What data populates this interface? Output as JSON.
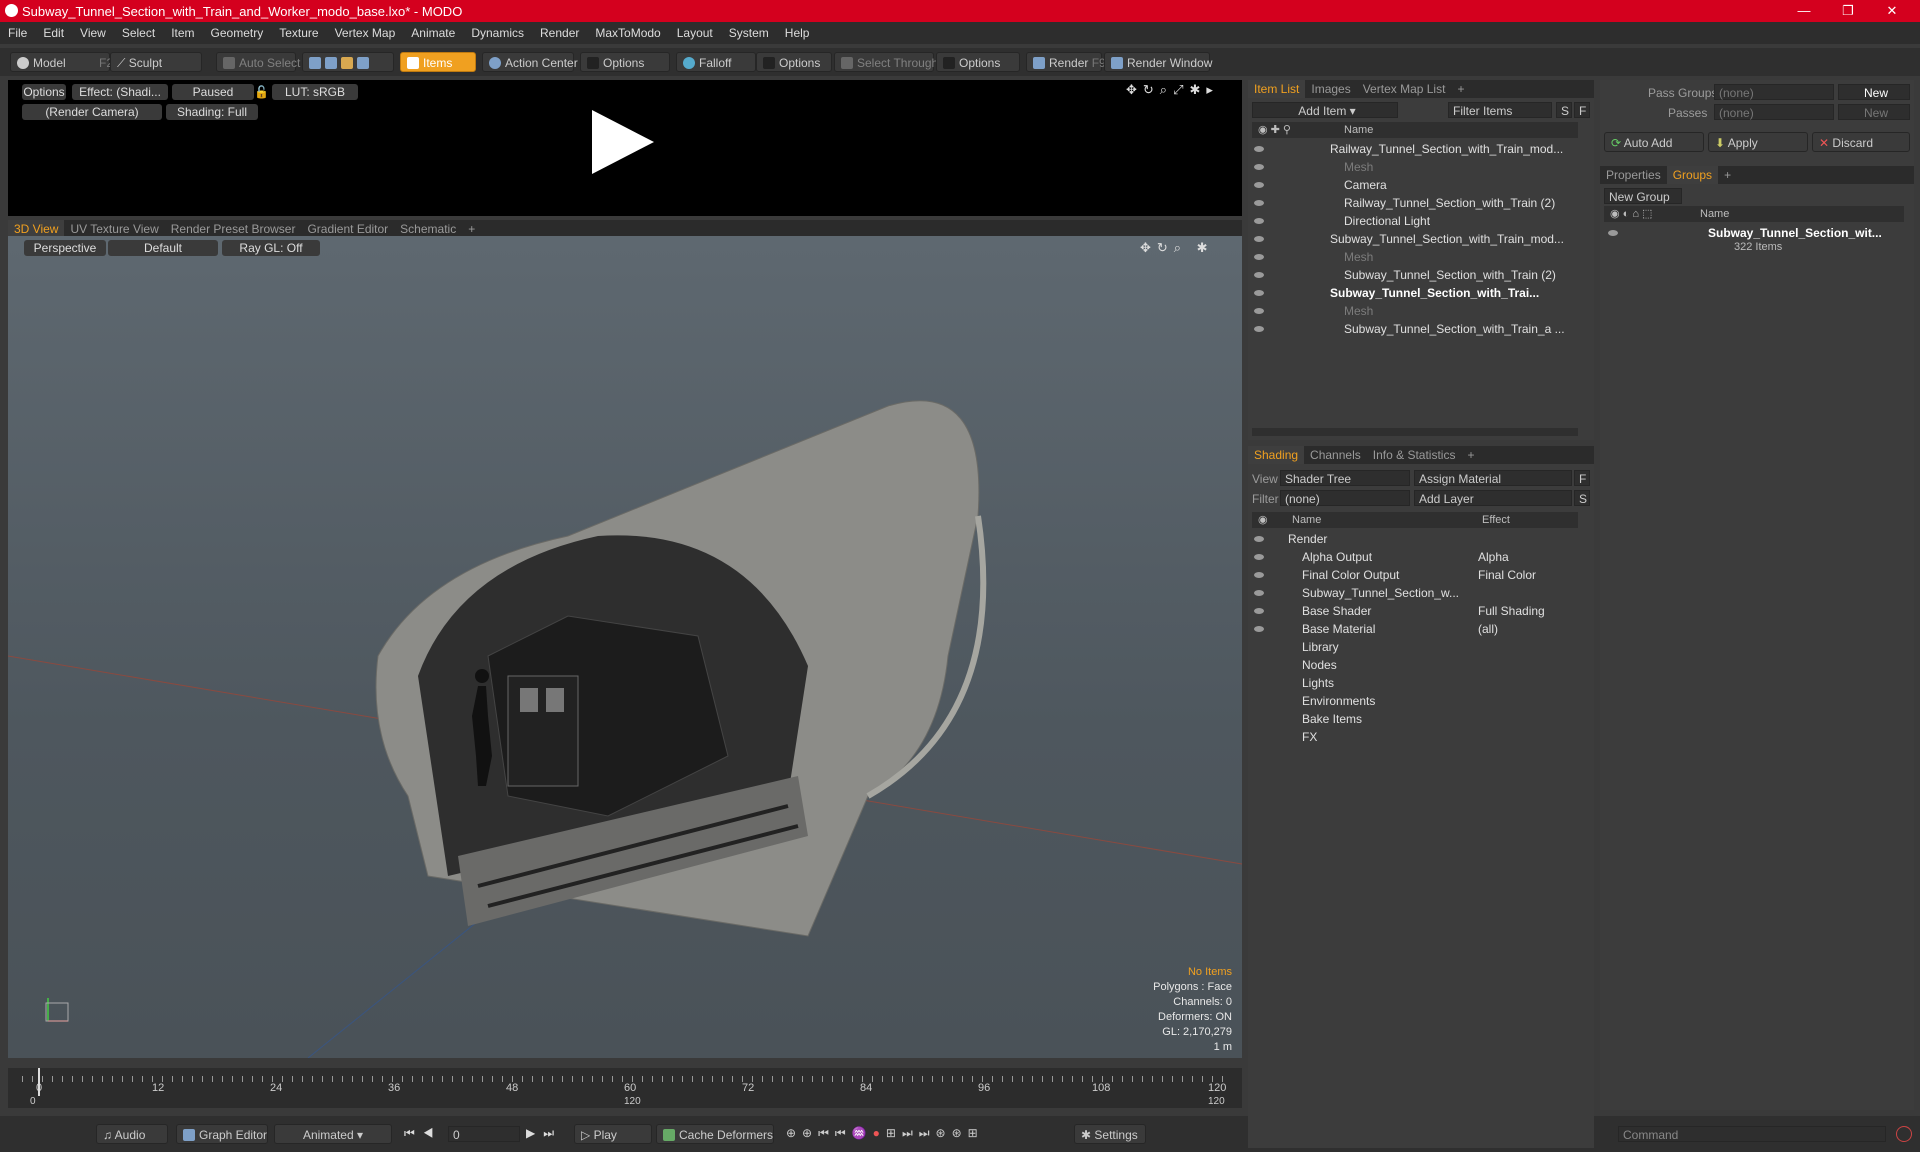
{
  "window": {
    "title": "Subway_Tunnel_Section_with_Train_and_Worker_modo_base.lxo* - MODO"
  },
  "menu": [
    "File",
    "Edit",
    "View",
    "Select",
    "Item",
    "Geometry",
    "Texture",
    "Vertex Map",
    "Animate",
    "Dynamics",
    "Render",
    "MaxToModo",
    "Layout",
    "System",
    "Help"
  ],
  "toolbar": {
    "model": "Model",
    "model_key": "F2",
    "sculpt": "Sculpt",
    "auto_select": "Auto Select",
    "items": "Items",
    "action_center": "Action Center",
    "options1": "Options",
    "falloff": "Falloff",
    "options2": "Options",
    "select_through": "Select Through",
    "options3": "Options",
    "render": "Render",
    "render_key": "F9",
    "render_window": "Render Window"
  },
  "preview": {
    "options": "Options",
    "effect": "Effect: (Shadi...",
    "paused": "Paused",
    "lut": "LUT: sRGB",
    "camera": "(Render Camera)",
    "shading": "Shading: Full"
  },
  "view_tabs": [
    "3D View",
    "UV Texture View",
    "Render Preset Browser",
    "Gradient Editor",
    "Schematic",
    "+"
  ],
  "viewport": {
    "perspective": "Perspective",
    "default": "Default",
    "raygl": "Ray GL: Off"
  },
  "stats": {
    "no_items": "No Items",
    "polygons": "Polygons : Face",
    "channels": "Channels: 0",
    "deformers": "Deformers: ON",
    "gl": "GL: 2,170,279",
    "scale": "1 m"
  },
  "timeline": {
    "ticks": [
      "0",
      "12",
      "24",
      "36",
      "48",
      "60",
      "72",
      "84",
      "96",
      "108",
      "120"
    ],
    "start": "0",
    "mid": "120",
    "end": "120"
  },
  "bottom": {
    "audio": "Audio",
    "graph_editor": "Graph Editor",
    "animated": "Animated",
    "frame": "0",
    "play": "Play",
    "cache": "Cache Deformers",
    "settings": "Settings",
    "command": "Command"
  },
  "item_list": {
    "tabs": [
      "Item List",
      "Images",
      "Vertex Map List",
      "+"
    ],
    "add_item": "Add Item",
    "filter": "Filter Items",
    "s": "S",
    "f": "F",
    "name_header": "Name",
    "rows": [
      {
        "label": "Railway_Tunnel_Section_with_Train_mod...",
        "indent": 0,
        "style": "normal"
      },
      {
        "label": "Mesh",
        "indent": 1,
        "style": "dim"
      },
      {
        "label": "Camera",
        "indent": 1,
        "style": "normal"
      },
      {
        "label": "Railway_Tunnel_Section_with_Train (2)",
        "indent": 1,
        "style": "normal"
      },
      {
        "label": "Directional Light",
        "indent": 1,
        "style": "normal"
      },
      {
        "label": "Subway_Tunnel_Section_with_Train_mod...",
        "indent": 0,
        "style": "normal"
      },
      {
        "label": "Mesh",
        "indent": 1,
        "style": "dim"
      },
      {
        "label": "Subway_Tunnel_Section_with_Train (2)",
        "indent": 1,
        "style": "normal"
      },
      {
        "label": "Subway_Tunnel_Section_with_Trai...",
        "indent": 0,
        "style": "bold"
      },
      {
        "label": "Mesh",
        "indent": 1,
        "style": "dim"
      },
      {
        "label": "Subway_Tunnel_Section_with_Train_a ...",
        "indent": 1,
        "style": "normal"
      }
    ]
  },
  "shading": {
    "tabs": [
      "Shading",
      "Channels",
      "Info & Statistics",
      "+"
    ],
    "view_label": "View",
    "view_value": "Shader Tree",
    "assign": "Assign Material",
    "f": "F",
    "filter_label": "Filter",
    "filter_value": "(none)",
    "add_layer": "Add Layer",
    "s": "S",
    "name_header": "Name",
    "effect_header": "Effect",
    "rows": [
      {
        "label": "Render",
        "effect": "",
        "indent": 0
      },
      {
        "label": "Alpha Output",
        "effect": "Alpha",
        "indent": 1
      },
      {
        "label": "Final Color Output",
        "effect": "Final Color",
        "indent": 1
      },
      {
        "label": "Subway_Tunnel_Section_w...",
        "effect": "",
        "indent": 1
      },
      {
        "label": "Base Shader",
        "effect": "Full Shading",
        "indent": 1
      },
      {
        "label": "Base Material",
        "effect": "(all)",
        "indent": 1
      },
      {
        "label": "Library",
        "effect": "",
        "indent": 0
      },
      {
        "label": "Nodes",
        "effect": "",
        "indent": 0
      },
      {
        "label": "Lights",
        "effect": "",
        "indent": 0
      },
      {
        "label": "Environments",
        "effect": "",
        "indent": 0
      },
      {
        "label": "Bake Items",
        "effect": "",
        "indent": 0
      },
      {
        "label": "FX",
        "effect": "",
        "indent": 0
      }
    ]
  },
  "groups": {
    "pass_groups": "Pass Groups",
    "passes": "Passes",
    "none1": "(none)",
    "none2": "(none)",
    "new1": "New",
    "new2": "New",
    "auto_add": "Auto Add",
    "apply": "Apply",
    "discard": "Discard",
    "tabs": [
      "Properties",
      "Groups",
      "+"
    ],
    "new_group": "New Group",
    "name_header": "Name",
    "group_name": "Subway_Tunnel_Section_wit...",
    "group_count": "322 Items"
  },
  "colors": {
    "accent": "#f0a020",
    "title_bar": "#d4001e"
  }
}
